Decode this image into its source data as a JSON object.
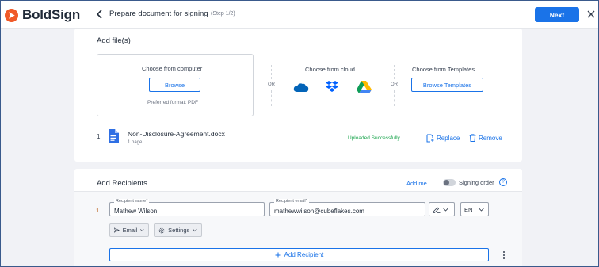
{
  "app": {
    "name": "BoldSign"
  },
  "header": {
    "title": "Prepare document for signing",
    "step": "(Step 1/2)",
    "next_label": "Next"
  },
  "files": {
    "section_title": "Add file(s)",
    "computer": {
      "heading": "Choose from computer",
      "browse_label": "Browse",
      "format_hint": "Preferred format: PDF"
    },
    "or_label": "OR",
    "cloud": {
      "heading": "Choose from cloud",
      "providers": [
        "onedrive-icon",
        "dropbox-icon",
        "google-drive-icon"
      ]
    },
    "templates": {
      "heading": "Choose from Templates",
      "browse_label": "Browse Templates"
    },
    "uploaded": [
      {
        "index": "1",
        "name": "Non-Disclosure-Agreement.docx",
        "pages": "1 page",
        "status": "Uploaded Successfully",
        "replace_label": "Replace",
        "remove_label": "Remove"
      }
    ]
  },
  "recipients": {
    "section_title": "Add Recipients",
    "add_me_label": "Add me",
    "signing_order_label": "Signing order",
    "help_label": "?",
    "list": [
      {
        "index": "1",
        "name_label": "Recipient name*",
        "name_value": "Mathew Wilson",
        "email_label": "Recipient email*",
        "email_value": "mathewwilson@cubeflakes.com",
        "language": "EN",
        "delivery_label": "Email",
        "settings_label": "Settings"
      }
    ],
    "add_recipient_label": "Add Recipient"
  },
  "colors": {
    "accent": "#1a73e8",
    "brand": "#f05a28",
    "success": "#16a34a"
  }
}
